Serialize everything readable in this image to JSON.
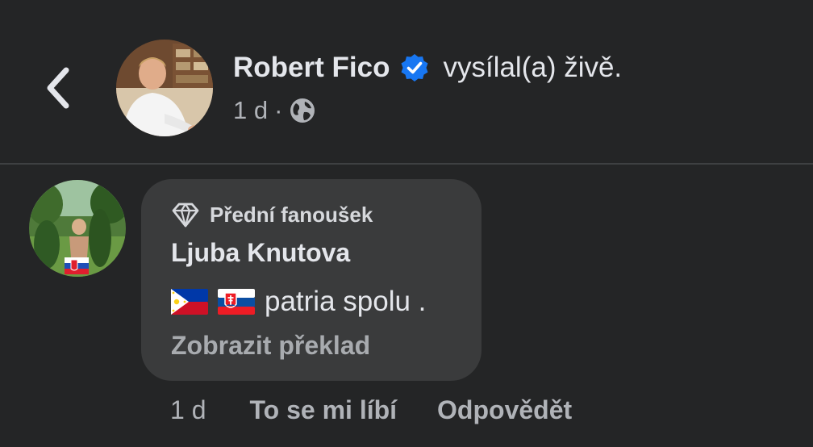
{
  "header": {
    "back_icon": "chevron-left-icon",
    "name": "Robert Fico",
    "verified_icon": "verified-badge-icon",
    "action": "vysílal(a) živě.",
    "time": "1 d",
    "separator": "·",
    "privacy_icon": "globe-icon"
  },
  "comment": {
    "badge_icon": "diamond-icon",
    "badge": "Přední fanoušek",
    "author": "Ljuba Knutova",
    "flags": [
      "philippines-flag-icon",
      "slovakia-flag-icon"
    ],
    "text": "patria spolu .",
    "translate": "Zobrazit překlad",
    "time": "1 d",
    "like": "To se mi líbí",
    "reply": "Odpovědět"
  },
  "colors": {
    "background": "#242526",
    "bubble": "#3a3b3c",
    "verified": "#1877f2",
    "text_primary": "#e4e6eb",
    "text_secondary": "#b0b3b8"
  }
}
